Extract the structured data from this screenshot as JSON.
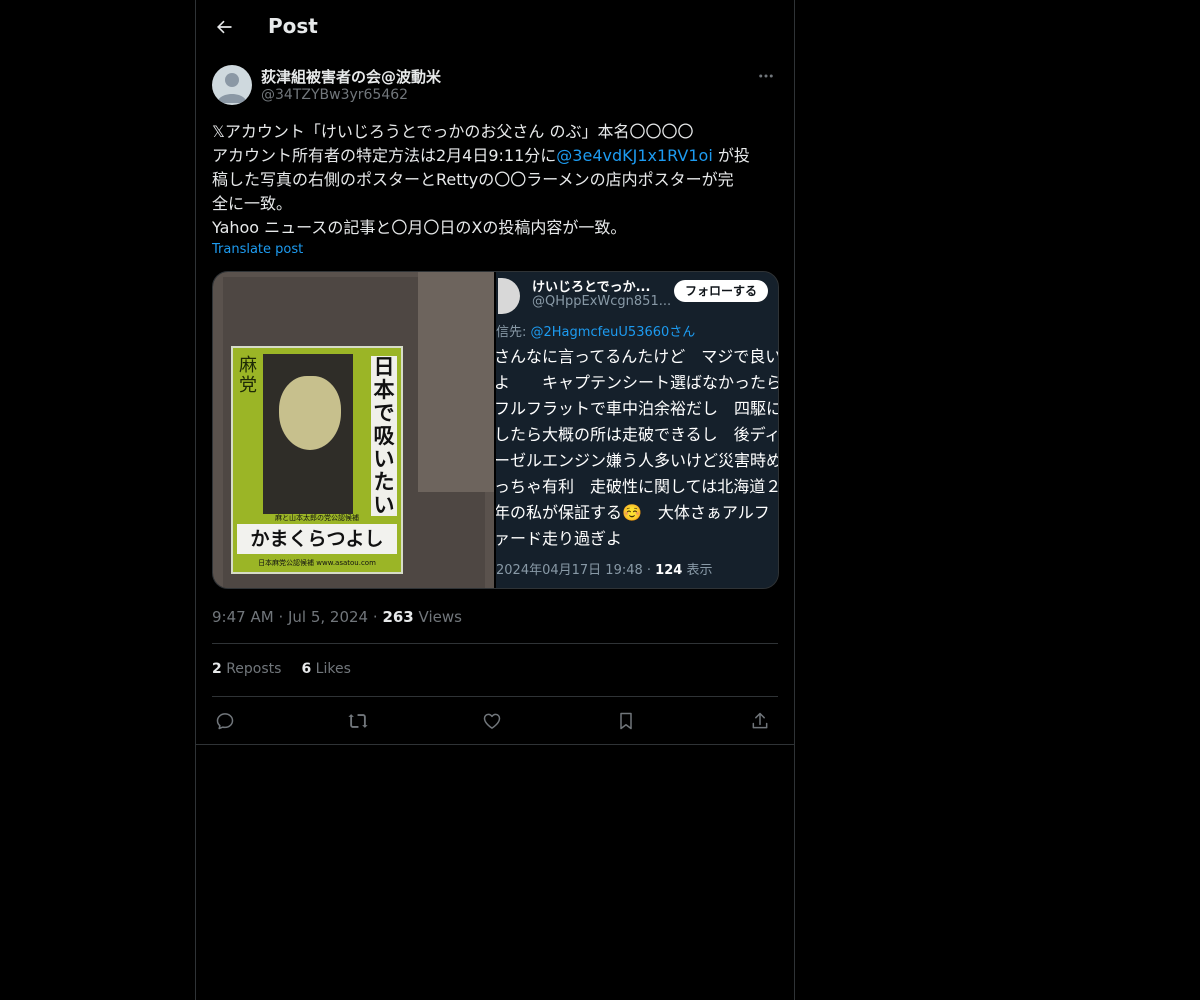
{
  "header": {
    "title": "Post"
  },
  "author": {
    "display_name": "荻津組被害者の会@波動米",
    "handle": "@34TZYBw3yr65462"
  },
  "post": {
    "lines": [
      "𝕏アカウント「けいじろうとでっかのお父さん のぶ」本名〇〇〇〇",
      "アカウント所有者の特定方法は2月4日9:11分に",
      "稿した写真の右側のポスターとRettyの〇〇ラーメンの店内ポスターが完",
      "全に一致。",
      "Yahoo ニュースの記事と〇月〇日のXの投稿内容が一致。"
    ],
    "mention": "@3e4vdKJ1x1RV1oi",
    "after_mention": " が投",
    "translate_label": "Translate post"
  },
  "media": {
    "poster": {
      "tag": "麻党",
      "vertical_text": "日本で吸いたい",
      "subtitle": "麻と山本太郎の党公認候補",
      "name": "かまくらつよし",
      "footer": "日本麻党公認候補 www.asatou.com"
    },
    "screenshot": {
      "name": "けいじろとでっか...",
      "handle": "@QHppExWcgn851...",
      "follow": "フォローする",
      "reply_prefix": "信先: ",
      "reply_mention": "@2HagmcfeuU53660さん",
      "body": [
        "さんなに言ってるんたけど　マジで良い",
        "よ　　キャプテンシート選ばなかったら",
        "フルフラットで車中泊余裕だし　四駆に",
        "したら大概の所は走破できるし　後ディ",
        "ーゼルエンジン嫌う人多いけど災害時め",
        "っちゃ有利　走破性に関しては北海道２",
        "年の私が保証する☺️　大体さぁアルフ",
        "ァード走り過ぎよ"
      ],
      "meta_date": "2024年04月17日 19:48 · ",
      "meta_count": "124",
      "meta_suffix": " 表示"
    }
  },
  "meta": {
    "time": "9:47 AM",
    "date": "Jul 5, 2024",
    "views_count": "263",
    "views_label": "Views"
  },
  "stats": {
    "reposts_count": "2",
    "reposts_label": "Reposts",
    "likes_count": "6",
    "likes_label": "Likes"
  },
  "colors": {
    "accent": "#1d9bf0",
    "muted": "#71767b",
    "text": "#e7e9ea",
    "border": "#2f3336"
  }
}
